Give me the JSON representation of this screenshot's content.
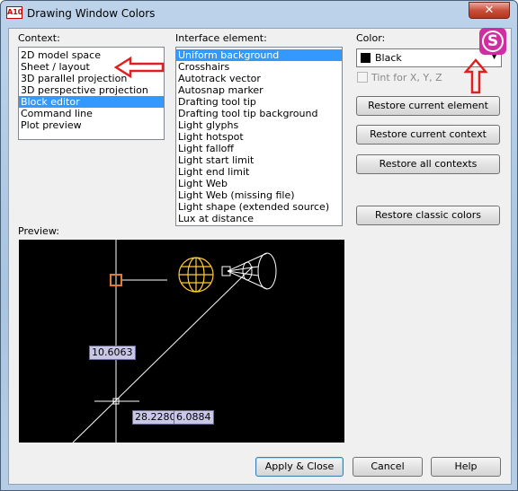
{
  "window": {
    "title": "Drawing Window Colors",
    "app_icon_text": "A10",
    "close_glyph": "✕"
  },
  "context": {
    "label": "Context:",
    "items": [
      "2D model space",
      "Sheet / layout",
      "3D parallel projection",
      "3D perspective projection",
      "Block editor",
      "Command line",
      "Plot preview"
    ],
    "selected": "Block editor"
  },
  "interface_element": {
    "label": "Interface element:",
    "items": [
      "Uniform background",
      "Crosshairs",
      "Autotrack vector",
      "Autosnap marker",
      "Drafting tool tip",
      "Drafting tool tip background",
      "Light glyphs",
      "Light hotspot",
      "Light falloff",
      "Light start limit",
      "Light end limit",
      "Light Web",
      "Light Web (missing file)",
      "Light shape (extended source)",
      "Lux at distance"
    ],
    "selected": "Uniform background"
  },
  "color": {
    "label": "Color:",
    "value": "Black",
    "swatch": "#000000",
    "tint_label": "Tint for X, Y, Z",
    "tint_checked": false
  },
  "buttons": {
    "restore_current_element": "Restore current element",
    "restore_current_context": "Restore current context",
    "restore_all_contexts": "Restore all contexts",
    "restore_classic_colors": "Restore classic colors",
    "apply_close": "Apply & Close",
    "cancel": "Cancel",
    "help": "Help"
  },
  "preview": {
    "label": "Preview:",
    "dim_vertical": "10.6063",
    "dim_x": "28.2280",
    "dim_y": "6.0884"
  },
  "overlay": {
    "logo_letter": "S",
    "logo_color": "#d02ea0",
    "annotation_color": "#e02020"
  },
  "colors": {
    "selection": "#3399ff",
    "preview_background": "#000000",
    "light_glyph": "#ffcc33",
    "light_web": "#ffffff",
    "marker": "#e07b2f",
    "tooltip_bg": "#c8c8e6"
  }
}
